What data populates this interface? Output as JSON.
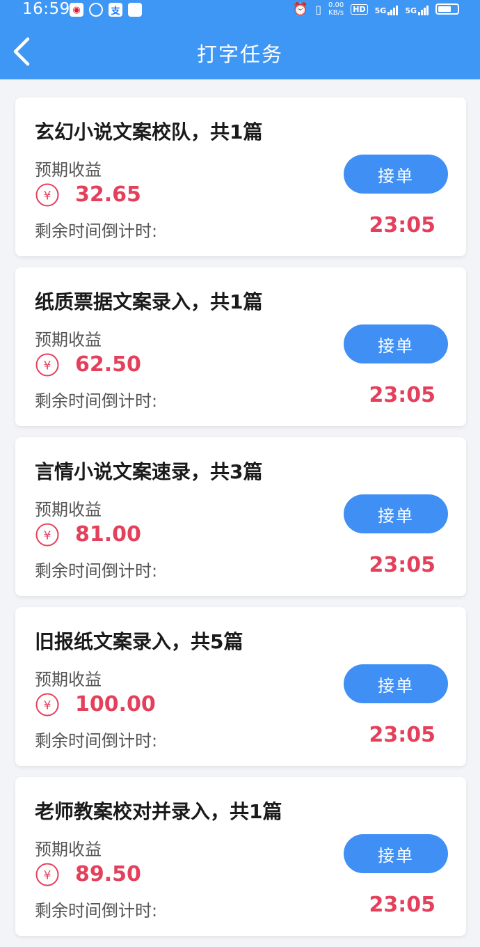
{
  "status_bar": {
    "time": "16:59",
    "speed_value": "0.00",
    "speed_unit": "KB/s",
    "hd_label": "HD",
    "signal_1": "5G",
    "signal_2": "5G"
  },
  "nav": {
    "title": "打字任务"
  },
  "tasks": [
    {
      "title": "玄幻小说文案校队，共1篇",
      "income_label": "预期收益",
      "amount": "32.65",
      "countdown_label": "剩余时间倒计时:",
      "time": "23:05",
      "button": "接单"
    },
    {
      "title": "纸质票据文案录入，共1篇",
      "income_label": "预期收益",
      "amount": "62.50",
      "countdown_label": "剩余时间倒计时:",
      "time": "23:05",
      "button": "接单"
    },
    {
      "title": "言情小说文案速录，共3篇",
      "income_label": "预期收益",
      "amount": "81.00",
      "countdown_label": "剩余时间倒计时:",
      "time": "23:05",
      "button": "接单"
    },
    {
      "title": "旧报纸文案录入，共5篇",
      "income_label": "预期收益",
      "amount": "100.00",
      "countdown_label": "剩余时间倒计时:",
      "time": "23:05",
      "button": "接单"
    },
    {
      "title": "老师教案校对并录入，共1篇",
      "income_label": "预期收益",
      "amount": "89.50",
      "countdown_label": "剩余时间倒计时:",
      "time": "23:05",
      "button": "接单"
    }
  ],
  "colors": {
    "header": "#3f97f5",
    "button": "#3f8ff4",
    "amount": "#e4405b"
  },
  "icons": {
    "back": "chevron-left-icon",
    "currency": "yen-icon"
  }
}
